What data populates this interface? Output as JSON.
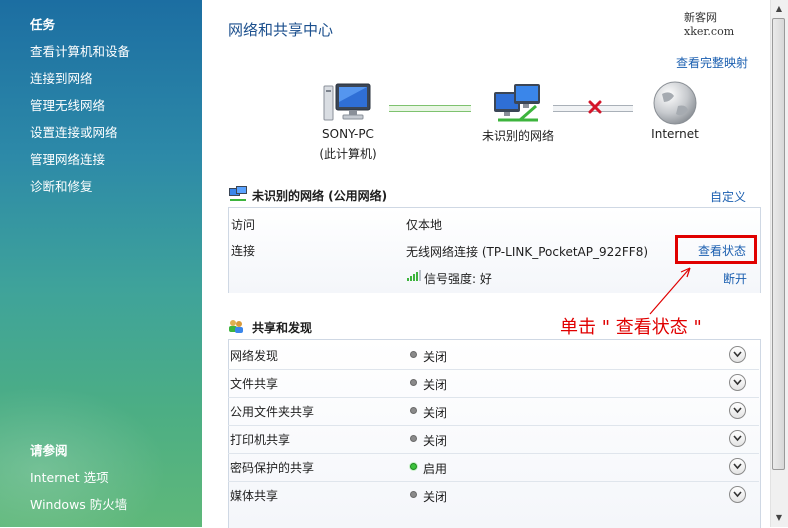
{
  "sidebar": {
    "tasks_heading": "任务",
    "tasks": [
      "查看计算机和设备",
      "连接到网络",
      "管理无线网络",
      "设置连接或网络",
      "管理网络连接",
      "诊断和修复"
    ],
    "see_also_heading": "请参阅",
    "see_also": [
      "Internet 选项",
      "Windows 防火墙"
    ]
  },
  "header": {
    "title": "网络和共享中心",
    "watermark": "新客网 xker.com",
    "full_map_link": "查看完整映射"
  },
  "network_map": {
    "computer_name": "SONY-PC",
    "computer_sub": "(此计算机)",
    "network_name": "未识别的网络",
    "internet_label": "Internet"
  },
  "network": {
    "heading": "未识别的网络 (公用网络)",
    "customize_link": "自定义",
    "access_label": "访问",
    "access_value": "仅本地",
    "connection_label": "连接",
    "connection_value": "无线网络连接 (TP-LINK_PocketAP_922FF8)",
    "view_status_link": "查看状态",
    "signal_label": "信号强度: 好",
    "disconnect_link": "断开"
  },
  "sharing": {
    "heading": "共享和发现",
    "rows": [
      {
        "label": "网络发现",
        "status": "关闭",
        "on": false
      },
      {
        "label": "文件共享",
        "status": "关闭",
        "on": false
      },
      {
        "label": "公用文件夹共享",
        "status": "关闭",
        "on": false
      },
      {
        "label": "打印机共享",
        "status": "关闭",
        "on": false
      },
      {
        "label": "密码保护的共享",
        "status": "启用",
        "on": true
      },
      {
        "label": "媒体共享",
        "status": "关闭",
        "on": false
      }
    ]
  },
  "annotation": {
    "text": "单击 \" 查看状态 \"",
    "color": "#e00000"
  }
}
